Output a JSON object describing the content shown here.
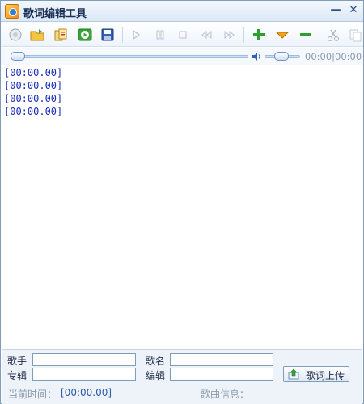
{
  "window": {
    "title": "歌词编辑工具",
    "minimize": "—",
    "close": "✕"
  },
  "toolbar": {
    "icons": [
      "new-icon",
      "open-folder-icon",
      "import-icon",
      "play-green-icon",
      "save-icon",
      "play-icon",
      "pause-icon",
      "stop-icon",
      "rewind-icon",
      "fast-forward-icon",
      "add-line-icon",
      "move-down-icon",
      "remove-line-icon",
      "cut-icon",
      "copy-icon"
    ]
  },
  "seek": {
    "position": 0,
    "volume": 0.3,
    "time": "00:00|00:00"
  },
  "lyrics": [
    "[00:00.00]",
    "[00:00.00]",
    "[00:00.00]",
    "[00:00.00]"
  ],
  "meta": {
    "singer_label": "歌手",
    "singer_value": "",
    "song_label": "歌名",
    "song_value": "",
    "album_label": "专辑",
    "album_value": "",
    "editor_label": "编辑",
    "editor_value": "",
    "upload_label": "歌词上传"
  },
  "status": {
    "current_time_label": "当前时间：",
    "current_time": "[00:00.00]",
    "song_info_label": "歌曲信息："
  },
  "colors": {
    "accent": "#2a5ca8",
    "lyric": "#1a2db8",
    "titlebar": "#dbe8f6"
  }
}
